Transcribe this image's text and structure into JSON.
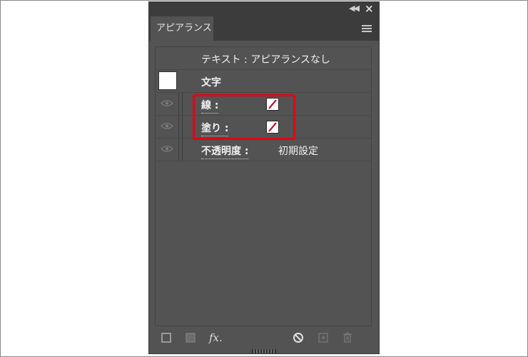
{
  "panel": {
    "tab_label": "アピアランス",
    "header_row": "テキスト : アピアランスなし",
    "char_row": "文字",
    "stroke_label": "線 :",
    "fill_label": "塗り :",
    "opacity_label": "不透明度 :",
    "opacity_value": "初期設定"
  },
  "bottom": {
    "fx_label": "fx."
  },
  "colors": {
    "panel_bg": "#535353",
    "highlight": "#e60012",
    "swatch_slash": "#c8102e"
  }
}
